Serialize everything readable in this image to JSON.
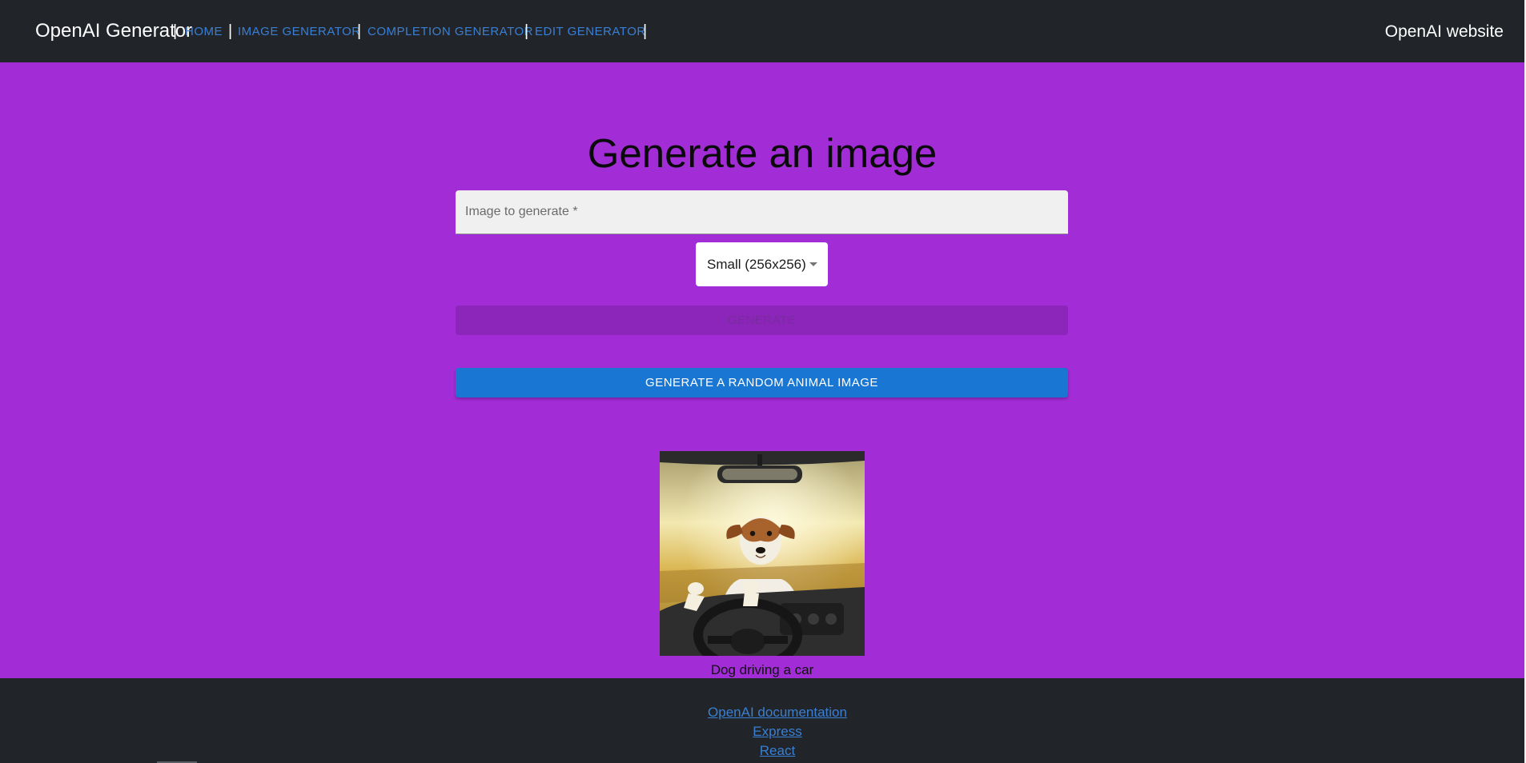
{
  "header": {
    "brand": "OpenAI Generator",
    "separator": "|",
    "nav": [
      {
        "label": "HOME"
      },
      {
        "label": "IMAGE GENERATOR"
      },
      {
        "label": "COMPLETION GENERATOR"
      },
      {
        "label": "EDIT GENERATOR"
      }
    ],
    "website_link": "OpenAI website"
  },
  "main": {
    "title": "Generate an image",
    "prompt_placeholder": "Image to generate *",
    "prompt_value": "",
    "size_select": {
      "selected": "Small (256x256)"
    },
    "generate_button": "GENERATE",
    "random_button": "GENERATE A RANDOM ANIMAL IMAGE",
    "image": {
      "subject": "dog-driving-car-photo",
      "caption": "Dog driving a car"
    }
  },
  "footer": {
    "links": [
      {
        "label": "OpenAI documentation"
      },
      {
        "label": "Express"
      },
      {
        "label": "React"
      }
    ]
  },
  "colors": {
    "navbar": "#212529",
    "page_background": "#a22cd6",
    "link_blue": "#3a7fd4",
    "primary_button": "#1976d2",
    "disabled_button": "#8c25b9"
  }
}
